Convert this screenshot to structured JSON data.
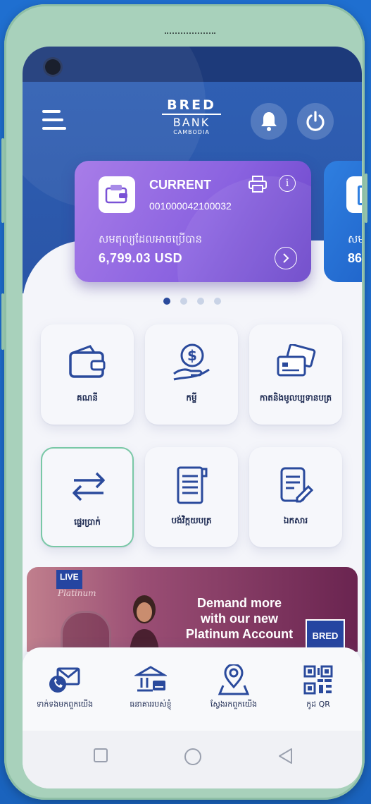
{
  "header": {
    "menu_icon": "hamburger-icon",
    "logo_line1": "BRED",
    "logo_line2": "BANK",
    "logo_line3": "CAMBODIA",
    "notifications_icon": "bell-icon",
    "logout_icon": "power-icon"
  },
  "accounts": [
    {
      "type": "CURRENT",
      "number": "001000042100032",
      "balance_label": "សមតុល្យដែលអាចប្រើបាន",
      "balance": "6,799.03 USD",
      "icon": "wallet-icon",
      "color": "#8a62e0"
    },
    {
      "balance_label": "សម",
      "balance": "86",
      "color": "#2f7fe0"
    }
  ],
  "carousel": {
    "pages": 4,
    "active": 0
  },
  "menu": [
    {
      "label": "គណនី",
      "icon": "wallet-icon"
    },
    {
      "label": "កម្ចី",
      "icon": "loan-coin-hand-icon"
    },
    {
      "label": "កាតនិងមូលប្បទានបត្រ",
      "icon": "cards-icon"
    },
    {
      "label": "ផ្ទេរប្រាក់",
      "icon": "transfer-arrows-icon",
      "selected": true
    },
    {
      "label": "បង់វិក្កយបត្រ",
      "icon": "bill-receipt-icon"
    },
    {
      "label": "ឯកសារ",
      "icon": "document-edit-icon"
    }
  ],
  "banner": {
    "badge": "LIVE",
    "script": "Platinum",
    "headline_1": "Demand more",
    "headline_2": "with our new",
    "headline_3": "Platinum Account",
    "brand": "BRED",
    "colors": {
      "start": "#c07f8d",
      "end": "#6a2450"
    }
  },
  "bottom_nav": [
    {
      "label": "ទាក់ទងមកពួកយើង",
      "icon": "contact-mail-phone-icon"
    },
    {
      "label": "ធនាគាររបស់ខ្ញុំ",
      "icon": "bank-icon"
    },
    {
      "label": "ស្វែងរកពួកយើង",
      "icon": "location-pin-icon"
    },
    {
      "label": "កូដ QR",
      "icon": "qr-code-icon"
    }
  ],
  "system_nav": [
    "recents-square-icon",
    "home-circle-icon",
    "back-triangle-icon"
  ],
  "theme": {
    "primary": "#2a55a7",
    "accent": "#79c8a6",
    "text": "#1d2a52"
  }
}
